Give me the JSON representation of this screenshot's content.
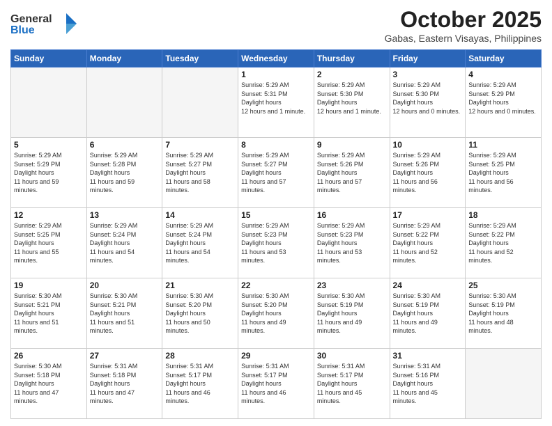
{
  "header": {
    "logo_general": "General",
    "logo_blue": "Blue",
    "month_title": "October 2025",
    "location": "Gabas, Eastern Visayas, Philippines"
  },
  "days_of_week": [
    "Sunday",
    "Monday",
    "Tuesday",
    "Wednesday",
    "Thursday",
    "Friday",
    "Saturday"
  ],
  "weeks": [
    [
      {
        "day": "",
        "empty": true
      },
      {
        "day": "",
        "empty": true
      },
      {
        "day": "",
        "empty": true
      },
      {
        "day": "1",
        "sunrise": "5:29 AM",
        "sunset": "5:31 PM",
        "daylight": "12 hours and 1 minute."
      },
      {
        "day": "2",
        "sunrise": "5:29 AM",
        "sunset": "5:30 PM",
        "daylight": "12 hours and 1 minute."
      },
      {
        "day": "3",
        "sunrise": "5:29 AM",
        "sunset": "5:30 PM",
        "daylight": "12 hours and 0 minutes."
      },
      {
        "day": "4",
        "sunrise": "5:29 AM",
        "sunset": "5:29 PM",
        "daylight": "12 hours and 0 minutes."
      }
    ],
    [
      {
        "day": "5",
        "sunrise": "5:29 AM",
        "sunset": "5:29 PM",
        "daylight": "11 hours and 59 minutes."
      },
      {
        "day": "6",
        "sunrise": "5:29 AM",
        "sunset": "5:28 PM",
        "daylight": "11 hours and 59 minutes."
      },
      {
        "day": "7",
        "sunrise": "5:29 AM",
        "sunset": "5:27 PM",
        "daylight": "11 hours and 58 minutes."
      },
      {
        "day": "8",
        "sunrise": "5:29 AM",
        "sunset": "5:27 PM",
        "daylight": "11 hours and 57 minutes."
      },
      {
        "day": "9",
        "sunrise": "5:29 AM",
        "sunset": "5:26 PM",
        "daylight": "11 hours and 57 minutes."
      },
      {
        "day": "10",
        "sunrise": "5:29 AM",
        "sunset": "5:26 PM",
        "daylight": "11 hours and 56 minutes."
      },
      {
        "day": "11",
        "sunrise": "5:29 AM",
        "sunset": "5:25 PM",
        "daylight": "11 hours and 56 minutes."
      }
    ],
    [
      {
        "day": "12",
        "sunrise": "5:29 AM",
        "sunset": "5:25 PM",
        "daylight": "11 hours and 55 minutes."
      },
      {
        "day": "13",
        "sunrise": "5:29 AM",
        "sunset": "5:24 PM",
        "daylight": "11 hours and 54 minutes."
      },
      {
        "day": "14",
        "sunrise": "5:29 AM",
        "sunset": "5:24 PM",
        "daylight": "11 hours and 54 minutes."
      },
      {
        "day": "15",
        "sunrise": "5:29 AM",
        "sunset": "5:23 PM",
        "daylight": "11 hours and 53 minutes."
      },
      {
        "day": "16",
        "sunrise": "5:29 AM",
        "sunset": "5:23 PM",
        "daylight": "11 hours and 53 minutes."
      },
      {
        "day": "17",
        "sunrise": "5:29 AM",
        "sunset": "5:22 PM",
        "daylight": "11 hours and 52 minutes."
      },
      {
        "day": "18",
        "sunrise": "5:29 AM",
        "sunset": "5:22 PM",
        "daylight": "11 hours and 52 minutes."
      }
    ],
    [
      {
        "day": "19",
        "sunrise": "5:30 AM",
        "sunset": "5:21 PM",
        "daylight": "11 hours and 51 minutes."
      },
      {
        "day": "20",
        "sunrise": "5:30 AM",
        "sunset": "5:21 PM",
        "daylight": "11 hours and 51 minutes."
      },
      {
        "day": "21",
        "sunrise": "5:30 AM",
        "sunset": "5:20 PM",
        "daylight": "11 hours and 50 minutes."
      },
      {
        "day": "22",
        "sunrise": "5:30 AM",
        "sunset": "5:20 PM",
        "daylight": "11 hours and 49 minutes."
      },
      {
        "day": "23",
        "sunrise": "5:30 AM",
        "sunset": "5:19 PM",
        "daylight": "11 hours and 49 minutes."
      },
      {
        "day": "24",
        "sunrise": "5:30 AM",
        "sunset": "5:19 PM",
        "daylight": "11 hours and 49 minutes."
      },
      {
        "day": "25",
        "sunrise": "5:30 AM",
        "sunset": "5:19 PM",
        "daylight": "11 hours and 48 minutes."
      }
    ],
    [
      {
        "day": "26",
        "sunrise": "5:30 AM",
        "sunset": "5:18 PM",
        "daylight": "11 hours and 47 minutes."
      },
      {
        "day": "27",
        "sunrise": "5:31 AM",
        "sunset": "5:18 PM",
        "daylight": "11 hours and 47 minutes."
      },
      {
        "day": "28",
        "sunrise": "5:31 AM",
        "sunset": "5:17 PM",
        "daylight": "11 hours and 46 minutes."
      },
      {
        "day": "29",
        "sunrise": "5:31 AM",
        "sunset": "5:17 PM",
        "daylight": "11 hours and 46 minutes."
      },
      {
        "day": "30",
        "sunrise": "5:31 AM",
        "sunset": "5:17 PM",
        "daylight": "11 hours and 45 minutes."
      },
      {
        "day": "31",
        "sunrise": "5:31 AM",
        "sunset": "5:16 PM",
        "daylight": "11 hours and 45 minutes."
      },
      {
        "day": "",
        "empty": true
      }
    ]
  ],
  "labels": {
    "sunrise": "Sunrise:",
    "sunset": "Sunset:",
    "daylight": "Daylight hours"
  }
}
